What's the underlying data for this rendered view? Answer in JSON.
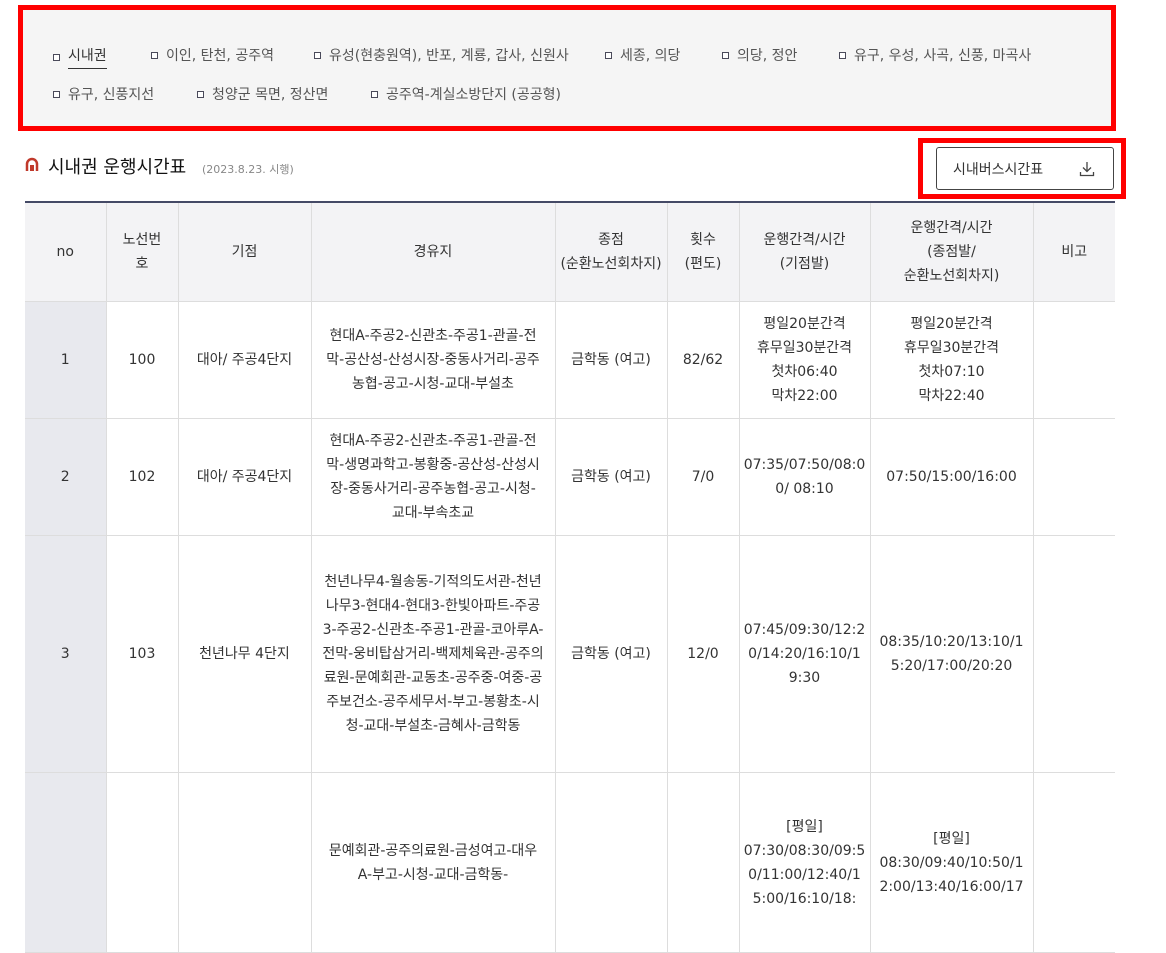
{
  "tabs": [
    {
      "label": "시내권",
      "active": true
    },
    {
      "label": "이인, 탄천, 공주역"
    },
    {
      "label": "유성(현충원역), 반포, 계룡, 갑사, 신원사"
    },
    {
      "label": "세종, 의당"
    },
    {
      "label": "의당, 정안"
    },
    {
      "label": "유구, 우성, 사곡, 신풍, 마곡사"
    },
    {
      "label": "유구, 신풍지선"
    },
    {
      "label": "청양군 목면, 정산면"
    },
    {
      "label": "공주역-계실소방단지 (공공형)"
    }
  ],
  "section": {
    "title": "시내권 운행시간표",
    "subtitle": "(2023.8.23. 시행)",
    "download_label": "시내버스시간표",
    "accent_color": "#c0392b"
  },
  "table": {
    "headers": [
      "no",
      "노선번호",
      "기점",
      "경유지",
      "종점\n(순환노선회차지)",
      "횟수\n(편도)",
      "운행간격/시간\n(기점발)",
      "운행간격/시간\n(종점발/\n순환노선회차지)",
      "비고"
    ],
    "rows": [
      {
        "no": "1",
        "route": "100",
        "start": "대아/ 주공4단지",
        "via": "현대A-주공2-신관초-주공1-관골-전막-공산성-산성시장-중동사거리-공주농협-공고-시청-교대-부설초",
        "end": "금학동 (여고)",
        "count": "82/62",
        "start_time": "평일20분간격\n휴무일30분간격\n첫차06:40\n막차22:00",
        "end_time": "평일20분간격\n휴무일30분간격\n첫차07:10\n막차22:40",
        "note": ""
      },
      {
        "no": "2",
        "route": "102",
        "start": "대아/ 주공4단지",
        "via": "현대A-주공2-신관초-주공1-관골-전막-생명과학고-봉황중-공산성-산성시장-중동사거리-공주농협-공고-시청-교대-부속초교",
        "end": "금학동 (여고)",
        "count": "7/0",
        "start_time": "07:35/07:50/08:00/ 08:10",
        "end_time": "07:50/15:00/16:00",
        "note": ""
      },
      {
        "no": "3",
        "route": "103",
        "start": "천년나무 4단지",
        "via": "천년나무4-월송동-기적의도서관-천년나무3-현대4-현대3-한빛아파트-주공3-주공2-신관초-주공1-관골-코아루A-전막-웅비탑삼거리-백제체육관-공주의료원-문예회관-교동초-공주중-여중-공주보건소-공주세무서-부고-봉황초-시청-교대-부설초-금혜사-금학동",
        "end": "금학동 (여고)",
        "count": "12/0",
        "start_time": "07:45/09:30/12:20/14:20/16:10/19:30",
        "end_time": "08:35/10:20/13:10/15:20/17:00/20:20",
        "note": ""
      },
      {
        "no": "",
        "route": "",
        "start": "",
        "via": "문예회관-공주의료원-금성여고-대우A-부고-시청-교대-금학동-",
        "end": "",
        "count": "",
        "start_time": "[평일]\n07:30/08:30/09:50/11:00/12:40/15:00/16:10/18:",
        "end_time": "[평일]\n08:30/09:40/10:50/12:00/13:40/16:00/17",
        "note": ""
      }
    ]
  }
}
